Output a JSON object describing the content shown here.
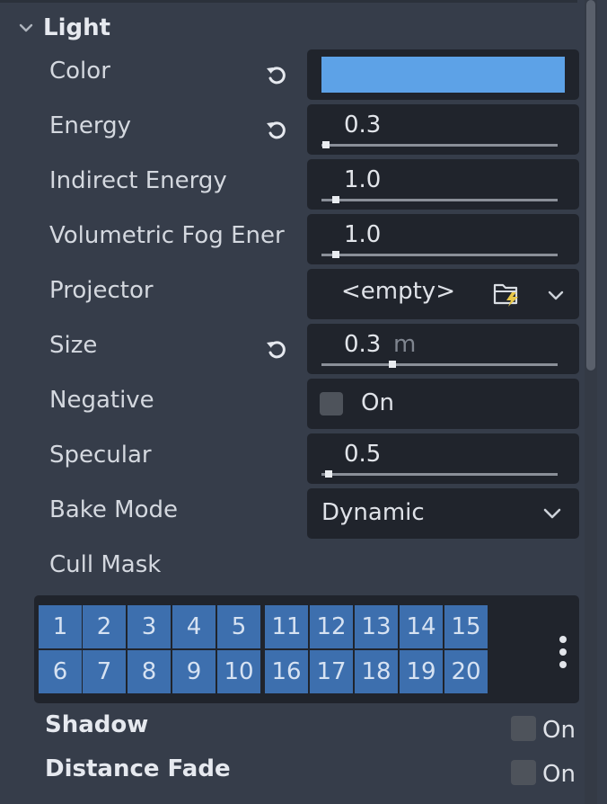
{
  "section": {
    "title": "Light"
  },
  "color": {
    "label": "Color",
    "value": "#5da2e7"
  },
  "energy": {
    "label": "Energy",
    "value": "0.3",
    "slider_fraction": 0.02
  },
  "indirect_energy": {
    "label": "Indirect Energy",
    "value": "1.0",
    "slider_fraction": 0.06
  },
  "volumetric_fog_energy": {
    "label": "Volumetric Fog Ener",
    "value": "1.0",
    "slider_fraction": 0.06
  },
  "projector": {
    "label": "Projector",
    "value": "<empty>"
  },
  "size": {
    "label": "Size",
    "value": "0.3",
    "unit": "m",
    "slider_fraction": 0.3
  },
  "negative": {
    "label": "Negative",
    "state_label": "On",
    "checked": false
  },
  "specular": {
    "label": "Specular",
    "value": "0.5",
    "slider_fraction": 0.03
  },
  "bake_mode": {
    "label": "Bake Mode",
    "value": "Dynamic"
  },
  "cull_mask": {
    "label": "Cull Mask",
    "bits": [
      [
        "1",
        "2",
        "3",
        "4",
        "5",
        "11",
        "12",
        "13",
        "14",
        "15"
      ],
      [
        "6",
        "7",
        "8",
        "9",
        "10",
        "16",
        "17",
        "18",
        "19",
        "20"
      ]
    ]
  },
  "shadow": {
    "label": "Shadow",
    "state_label": "On",
    "checked": false
  },
  "distance_fade": {
    "label": "Distance Fade",
    "state_label": "On",
    "checked": false
  },
  "colors": {
    "panel_bg": "#363d4a",
    "field_bg": "#20242c",
    "bit_on": "#3d6fae",
    "swatch": "#5da2e7"
  },
  "icons": {
    "revert": "revert-icon",
    "folder": "folder-load-icon",
    "dropdown": "chevron-down-icon",
    "more": "kebab-menu-icon"
  }
}
